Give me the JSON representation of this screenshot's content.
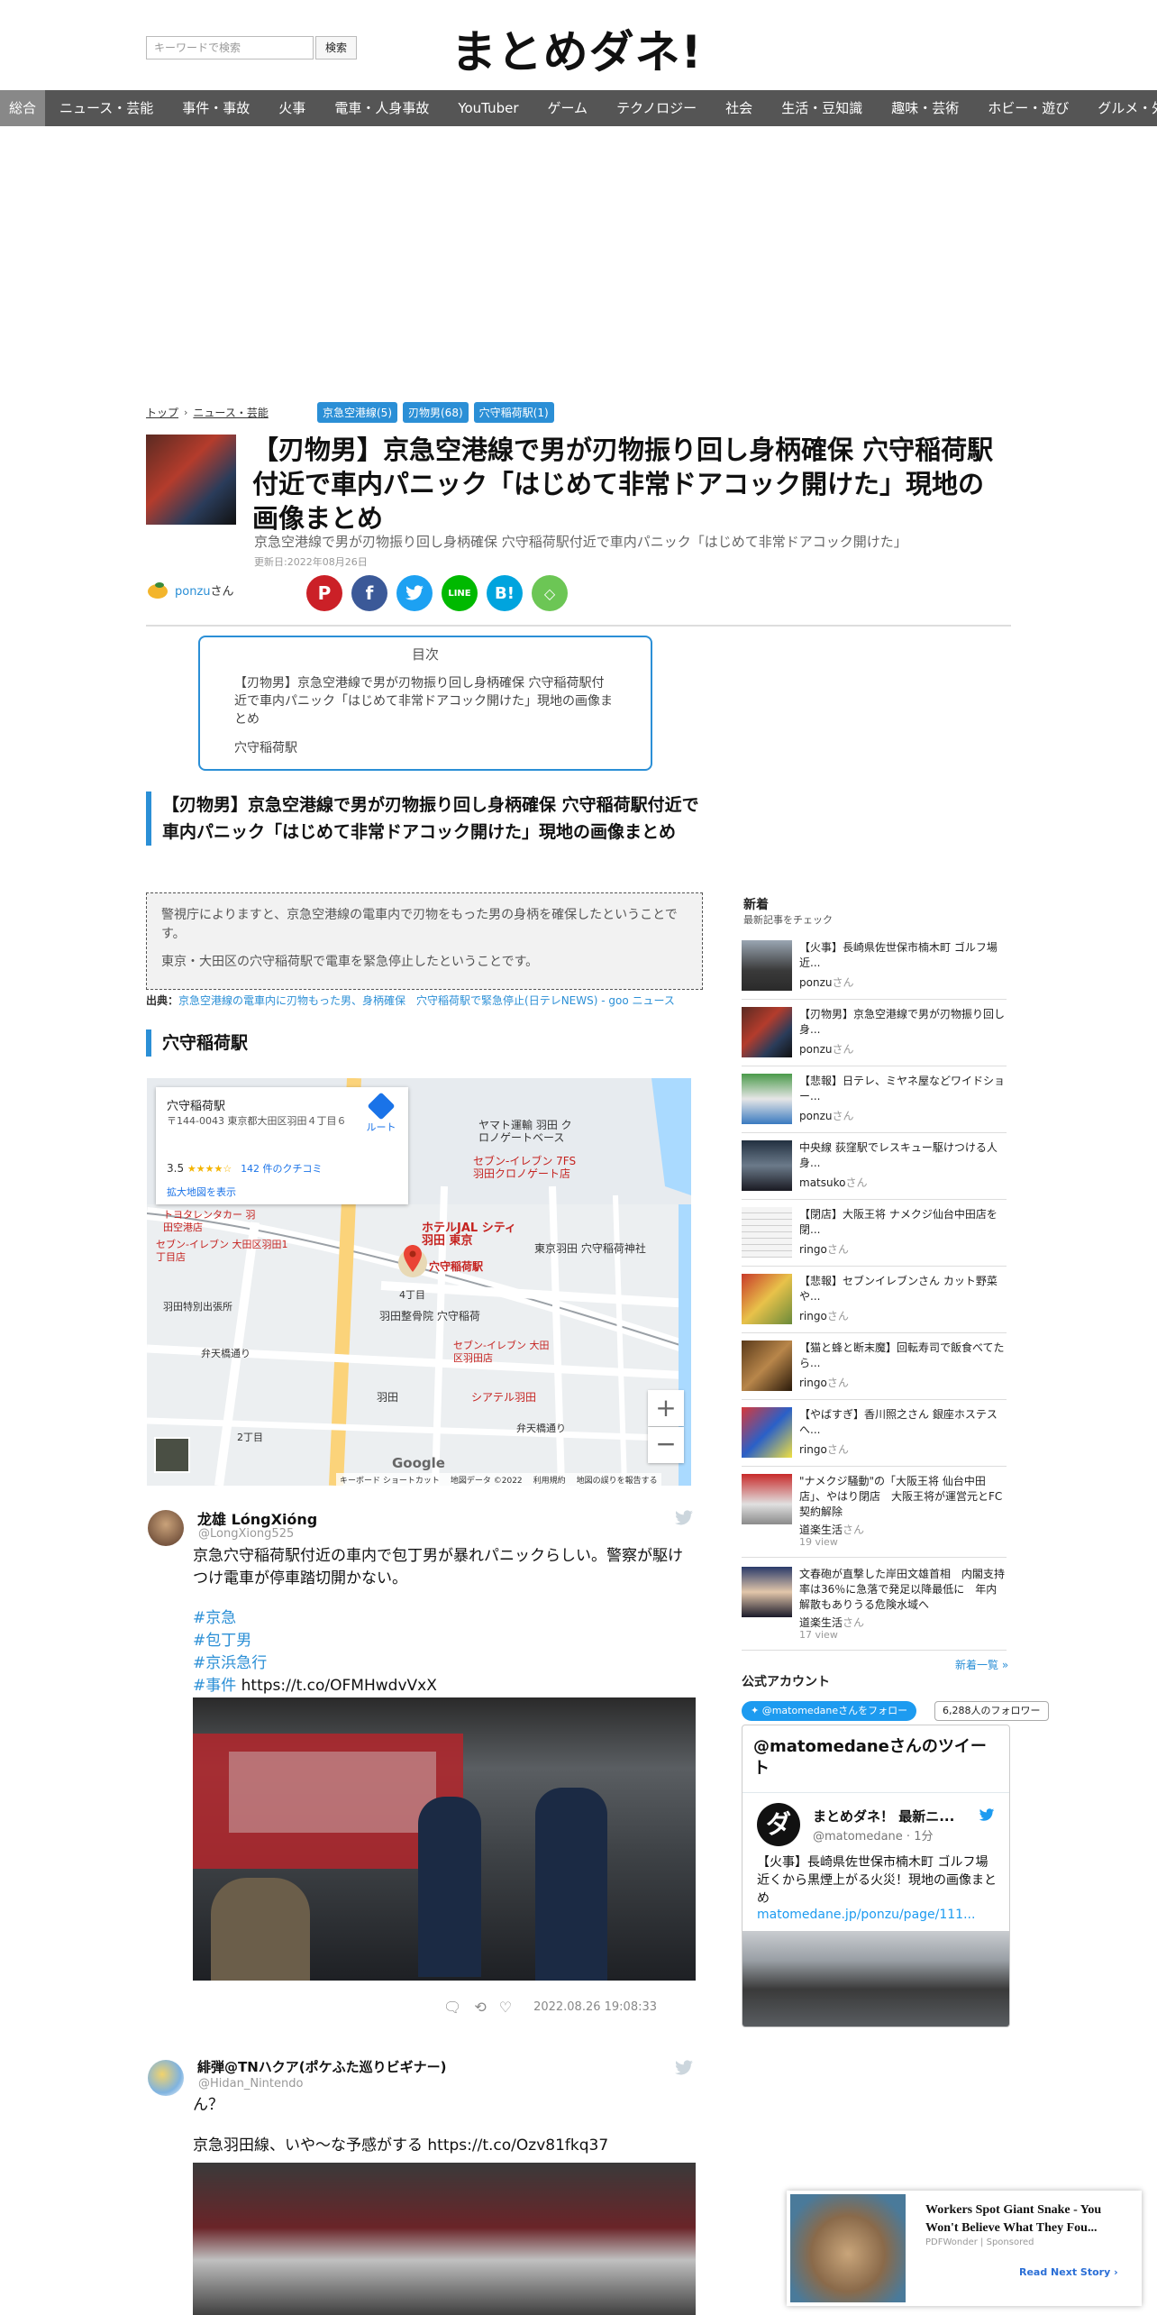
{
  "header": {
    "search_placeholder": "キーワードで検索",
    "search_button": "検索",
    "logo": "まとめダネ!"
  },
  "nav": [
    "総合",
    "ニュース・芸能",
    "事件・事故",
    "火事",
    "電車・人身事故",
    "YouTuber",
    "ゲーム",
    "テクノロジー",
    "社会",
    "生活・豆知識",
    "趣味・芸術",
    "ホビー・遊び",
    "グルメ・外食"
  ],
  "breadcrumb": {
    "home": "トップ",
    "category": "ニュース・芸能"
  },
  "tags": [
    "京急空港線(5)",
    "刃物男(68)",
    "穴守稲荷駅(1)"
  ],
  "article": {
    "title": "【刃物男】京急空港線で男が刃物振り回し身柄確保 穴守稲荷駅付近で車内パニック「はじめて非常ドアコック開けた」現地の画像まとめ",
    "subtitle": "京急空港線で男が刃物振り回し身柄確保 穴守稲荷駅付近で車内パニック「はじめて非常ドアコック開けた」",
    "updated": "更新日:2022年08月26日",
    "author": "ponzu",
    "author_suffix": "さん",
    "share_icons": [
      "pinterest-icon",
      "facebook-icon",
      "twitter-icon",
      "line-icon",
      "hatena-icon",
      "feedly-icon"
    ],
    "toc": {
      "title": "目次",
      "items": [
        "【刃物男】京急空港線で男が刃物振り回し身柄確保 穴守稲荷駅付近で車内パニック「はじめて非常ドアコック開けた」現地の画像まとめ",
        "穴守稲荷駅"
      ]
    },
    "h2_first": "【刃物男】京急空港線で男が刃物振り回し身柄確保 穴守稲荷駅付近で車内パニック「はじめて非常ドアコック開けた」現地の画像まとめ",
    "quote": [
      "警視庁によりますと、京急空港線の電車内で刃物をもった男の身柄を確保したということです。",
      "東京・大田区の穴守稲荷駅で電車を緊急停止したということです。"
    ],
    "source_label": "出典：",
    "source_link": "京急空港線の電車内に刃物もった男、身柄確保　穴守稲荷駅で緊急停止(日テレNEWS) - goo ニュース",
    "h2_second": "穴守稲荷駅"
  },
  "map": {
    "place_name": "穴守稲荷駅",
    "address": "〒144-0043 東京都大田区羽田４丁目６",
    "rating": "3.5",
    "stars": "★★★★☆",
    "reviews": "142 件のクチコミ",
    "enlarge": "拡大地図を表示",
    "route": "ルート",
    "labels": {
      "marker": "穴守稲荷駅",
      "hotel": "ホテルJAL シティ羽田 東京",
      "yamato": "ヤマト運輸 羽田 クロノゲートベース",
      "seven1": "セブン-イレブン 7FS 羽田クロノゲート店",
      "toyota": "トヨタレンタカー 羽田空港店",
      "seven2": "セブン-イレブン 大田区羽田1丁目店",
      "shrine": "東京羽田 穴守稲荷神社",
      "post": "羽田特別出張所",
      "benten": "弁天橋通り",
      "clinic": "羽田整骨院 穴守稲荷",
      "seven3": "セブン-イレブン 大田区羽田店",
      "shiatel": "シアテル羽田",
      "haneda": "羽田",
      "chome4": "4丁目",
      "chome2": "2丁目",
      "benten2": "弁天橋通り"
    },
    "footer": [
      "キーボード ショートカット",
      "地図データ ©2022",
      "利用規約",
      "地図の誤りを報告する"
    ],
    "google": "Google"
  },
  "tweets": [
    {
      "name": "龙雄 LóngXióng",
      "handle": "@LongXiong525",
      "text": "京急穴守稲荷駅付近の車内で包丁男が暴れパニックらしい。警察が駆けつけ電車が停車踏切開かない。",
      "hashtags": [
        "#京急",
        "#包丁男",
        "#京浜急行"
      ],
      "last_tag": "#事件",
      "url": "https://t.co/OFMHwdvVxX",
      "time": "2022.08.26 19:08:33"
    },
    {
      "name": "緋弾@TNハクア(ポケふた巡りビギナー)",
      "handle": "@Hidan_Nintendo",
      "text1": "ん？",
      "text2": "京急羽田線、いや〜な予感がする https://t.co/Ozv81fkq37"
    }
  ],
  "sidebar": {
    "title": "新着",
    "subtitle": "最新記事をチェック",
    "items": [
      {
        "title": "【火事】長崎県佐世保市楠木町 ゴルフ場近...",
        "user": "ponzu"
      },
      {
        "title": "【刃物男】京急空港線で男が刃物振り回し身...",
        "user": "ponzu"
      },
      {
        "title": "【悲報】日テレ、ミヤネ屋などワイドショー...",
        "user": "ponzu"
      },
      {
        "title": "中央線 荻窪駅でレスキュー駆けつける人身...",
        "user": "matsuko"
      },
      {
        "title": "【閉店】大阪王将 ナメクジ仙台中田店を閉...",
        "user": "ringo"
      },
      {
        "title": "【悲報】セブンイレブンさん カット野菜や...",
        "user": "ringo"
      },
      {
        "title": "【猫と蜂と断末魔】回転寿司で飯食べてたら...",
        "user": "ringo"
      },
      {
        "title": "【やばすぎ】香川照之さん 銀座ホステスへ...",
        "user": "ringo"
      },
      {
        "title": "\"ナメクジ騒動\"の「大阪王将 仙台中田店」、やはり閉店　大阪王将が運営元とFC契約解除",
        "user": "道楽生活",
        "views": "19 view"
      },
      {
        "title": "文春砲が直撃した岸田文雄首相　内閣支持率は36％に急落で発足以降最低に　年内解散もありうる危険水域へ",
        "user": "道楽生活",
        "views": "17 view"
      }
    ],
    "user_suffix": "さん",
    "more": "新着一覧 »",
    "official": "公式アカウント",
    "follow_button": "@matomedaneさんをフォロー",
    "followers": "6,288人のフォロワー",
    "widget": {
      "heading": "@matomedaneさんのツイート",
      "name": "まとめダネ！ 最新ニ...",
      "handle": "@matomedane · 1分",
      "text": "【火事】長崎県佐世保市楠木町 ゴルフ場近くから黒煙上がる火災！現地の画像まとめ",
      "link": "matomedane.jp/ponzu/page/111..."
    }
  },
  "ad": {
    "headline": "Workers Spot Giant Snake - You Won't Believe What They Fou...",
    "source": "PDFWonder",
    "sponsored": "Sponsored",
    "cta": "Read Next Story ›"
  },
  "colors": {
    "accent": "#2b8fd6",
    "nav_bg": "#555555",
    "twitter": "#1d9bf0"
  }
}
